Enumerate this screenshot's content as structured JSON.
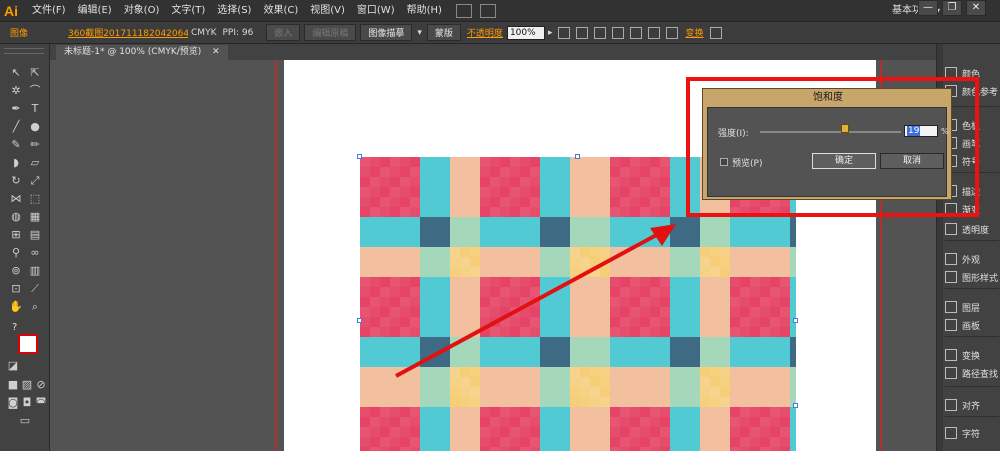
{
  "app": {
    "logo": "Ai",
    "menu": [
      "文件(F)",
      "编辑(E)",
      "对象(O)",
      "文字(T)",
      "选择(S)",
      "效果(C)",
      "视图(V)",
      "窗口(W)",
      "帮助(H)"
    ],
    "workspace": "基本功能",
    "workspace_arrow": "▾",
    "window_buttons": [
      "—",
      "❐",
      "✕"
    ]
  },
  "controlbar": {
    "selection_type": "图像",
    "file_link": "360截图20171118204206​4...",
    "color_mode": "CMYK",
    "ppi": "PPI: 96",
    "embed_label": "嵌入",
    "edit_original_label": "编辑原稿",
    "image_trace_label": "图像描摹",
    "mask_label": "蒙版",
    "opacity_label": "不透明度",
    "opacity_value": "100%",
    "transform_label": "变换"
  },
  "document": {
    "tab_title": "未标题-1* @ 100% (CMYK/预览)",
    "tab_close": "✕"
  },
  "tools": {
    "fill_stroke_label": "?"
  },
  "right_panel": {
    "items": [
      "颜色",
      "颜色参考",
      "色板",
      "画笔",
      "符号",
      "描边",
      "渐变",
      "透明度",
      "外观",
      "图形样式",
      "图层",
      "画板",
      "变换",
      "路径查找",
      "对齐",
      "字符"
    ]
  },
  "dialog": {
    "title": "饱和度",
    "intensity_label": "强度(I):",
    "intensity_value": "19",
    "intensity_fraction": 0.6,
    "percent": "%",
    "preview_label": "预览(P)",
    "preview_checked": false,
    "ok_label": "确定",
    "cancel_label": "取消"
  },
  "colors": {
    "accent": "#ff9a00",
    "annotation": "#e11111",
    "dialog_frame": "#c8a56a",
    "pattern": [
      "#e43a5f",
      "#f7c04a",
      "#35c3d0",
      "#f6eee0",
      "#2a5b7a",
      "#6fc9a0",
      "#f09a6a"
    ]
  }
}
